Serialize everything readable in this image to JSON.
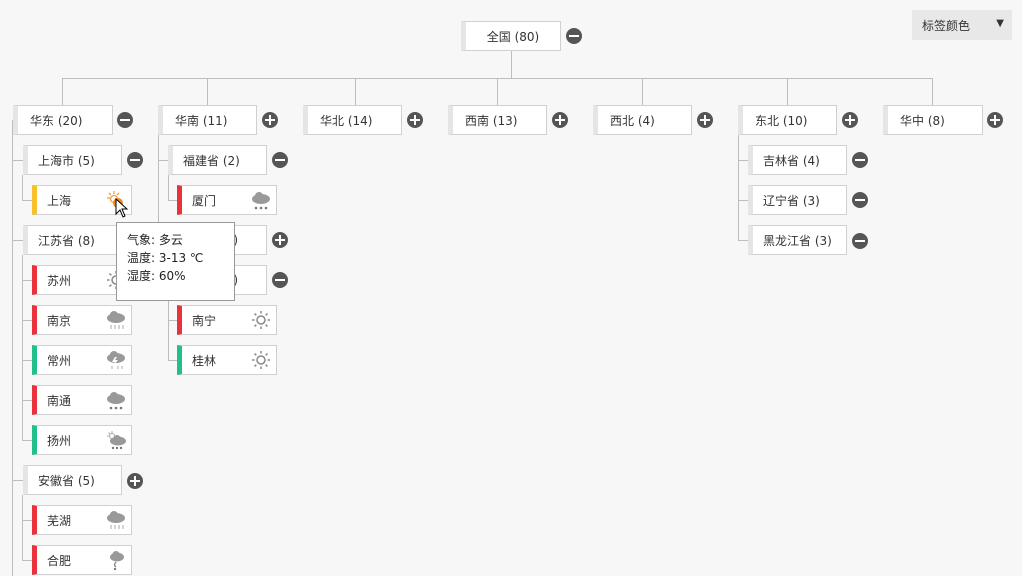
{
  "label_color_dropdown": {
    "label": "标签颜色",
    "arrow": "▼"
  },
  "root": {
    "label": "全国 (80)"
  },
  "regions": [
    {
      "label": "华东 (20)",
      "toggle": "minus"
    },
    {
      "label": "华南 (11)",
      "toggle": "plus"
    },
    {
      "label": "华北 (14)",
      "toggle": "plus"
    },
    {
      "label": "西南 (13)",
      "toggle": "plus"
    },
    {
      "label": "西北 (4)",
      "toggle": "plus"
    },
    {
      "label": "东北 (10)",
      "toggle": "plus"
    },
    {
      "label": "华中 (8)",
      "toggle": "plus"
    }
  ],
  "huadong": {
    "shanghai_shi": {
      "label": "上海市 (5)",
      "toggle": "minus",
      "cities": [
        {
          "label": "上海",
          "weather": "partly-cloudy-sun-icon",
          "color": "yellow"
        }
      ]
    },
    "jiangsu": {
      "label": "江苏省 (8)",
      "toggle": "minus",
      "cities": [
        {
          "label": "苏州",
          "weather": "sun-icon",
          "color": "red"
        },
        {
          "label": "南京",
          "weather": "rain-cloud-icon",
          "color": "red"
        },
        {
          "label": "常州",
          "weather": "thunderstorm-icon",
          "color": "green"
        },
        {
          "label": "南通",
          "weather": "snow-cloud-icon",
          "color": "red"
        },
        {
          "label": "扬州",
          "weather": "sun-shower-icon",
          "color": "green"
        }
      ]
    },
    "anhui": {
      "label": "安徽省 (5)",
      "toggle": "plus",
      "cities": [
        {
          "label": "芜湖",
          "weather": "rain-cloud-icon",
          "color": "red"
        },
        {
          "label": "合肥",
          "weather": "drizzle-icon",
          "color": "red"
        }
      ]
    }
  },
  "huanan": {
    "fujian": {
      "label": "福建省 (2)",
      "toggle": "minus",
      "cities": [
        {
          "label": "厦门",
          "weather": "snow-cloud-icon",
          "color": "red"
        }
      ]
    },
    "hidden_province_1": {
      "label": ")",
      "toggle": "plus"
    },
    "hidden_province_2": {
      "label": ")",
      "toggle": "minus",
      "cities": [
        {
          "label": "南宁",
          "weather": "sun-icon",
          "color": "red"
        },
        {
          "label": "桂林",
          "weather": "sun-icon",
          "color": "green"
        }
      ]
    }
  },
  "dongbei": {
    "provinces": [
      {
        "label": "吉林省 (4)",
        "toggle": "minus"
      },
      {
        "label": "辽宁省 (3)",
        "toggle": "minus"
      },
      {
        "label": "黑龙江省 (3)",
        "toggle": "minus"
      }
    ]
  },
  "tooltip": {
    "condition": "气象: 多云",
    "temperature": "温度: 3-13 ℃",
    "humidity": "湿度: 60%"
  },
  "colors": {
    "red": "#e8323c",
    "yellow": "#f6c12c",
    "green": "#21c08b",
    "toggle": "#555555"
  }
}
